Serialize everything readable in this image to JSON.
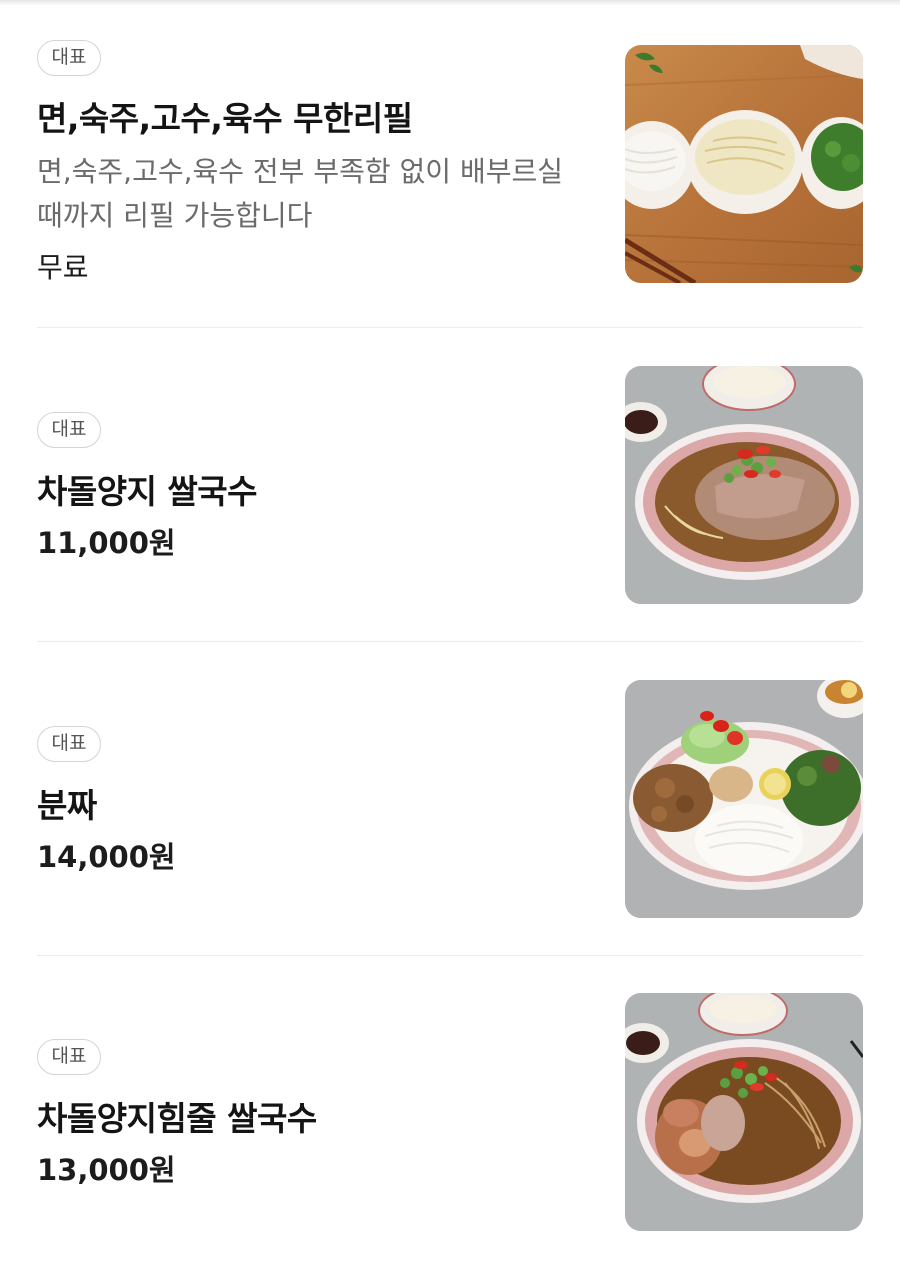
{
  "menu": {
    "items": [
      {
        "badge": "대표",
        "name": "면,숙주,고수,육수 무한리필",
        "description": "면,숙주,고수,육수 전부 부족함 없이 배부르실 때까지 리필 가능합니다",
        "price": "무료",
        "image_icon": "noodle-sides-photo"
      },
      {
        "badge": "대표",
        "name": "차돌양지 쌀국수",
        "price": "11,000원",
        "image_icon": "pho-bowl-photo"
      },
      {
        "badge": "대표",
        "name": "분짜",
        "price": "14,000원",
        "image_icon": "bun-cha-plate-photo"
      },
      {
        "badge": "대표",
        "name": "차돌양지힘줄 쌀국수",
        "price": "13,000원",
        "image_icon": "pho-tendon-bowl-photo"
      }
    ]
  },
  "colors": {
    "text_primary": "#141414",
    "text_secondary": "#6b6b6b",
    "badge_border": "#d4d4d4",
    "divider": "#ececec"
  }
}
